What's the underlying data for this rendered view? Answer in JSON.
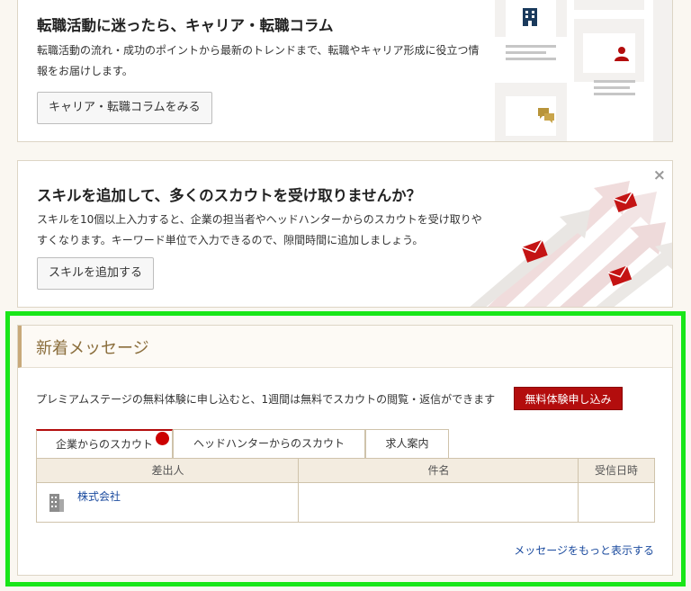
{
  "column_card": {
    "title": "転職活動に迷ったら、キャリア・転職コラム",
    "description": "転職活動の流れ・成功のポイントから最新のトレンドまで、転職やキャリア形成に役立つ情報をお届けします。",
    "button_label": "キャリア・転職コラムをみる"
  },
  "skill_card": {
    "title": "スキルを追加して、多くのスカウトを受け取りませんか？",
    "description": "スキルを10個以上入力すると、企業の担当者やヘッドハンターからのスカウトを受け取りやすくなります。キーワード単位で入力できるので、隙間時間に追加しましょう。",
    "button_label": "スキルを追加する",
    "close_label": "×"
  },
  "messages": {
    "title": "新着メッセージ",
    "promo_text": "プレミアムステージの無料体験に申し込むと、1週間は無料でスカウトの閲覧・返信ができます",
    "promo_button": "無料体験申し込み",
    "tabs": [
      {
        "label": "企業からのスカウト",
        "active": true,
        "badge": true
      },
      {
        "label": "ヘッドハンターからのスカウト",
        "active": false
      },
      {
        "label": "求人案内",
        "active": false
      }
    ],
    "columns": [
      "差出人",
      "件名",
      "受信日時"
    ],
    "rows": [
      {
        "sender": "株式会社",
        "subject": "",
        "date": ""
      }
    ],
    "more_link": "メッセージをもっと表示する"
  },
  "colors": {
    "accent_red": "#b30d0d",
    "highlight": "#19e619",
    "link": "#1a4a9e"
  }
}
